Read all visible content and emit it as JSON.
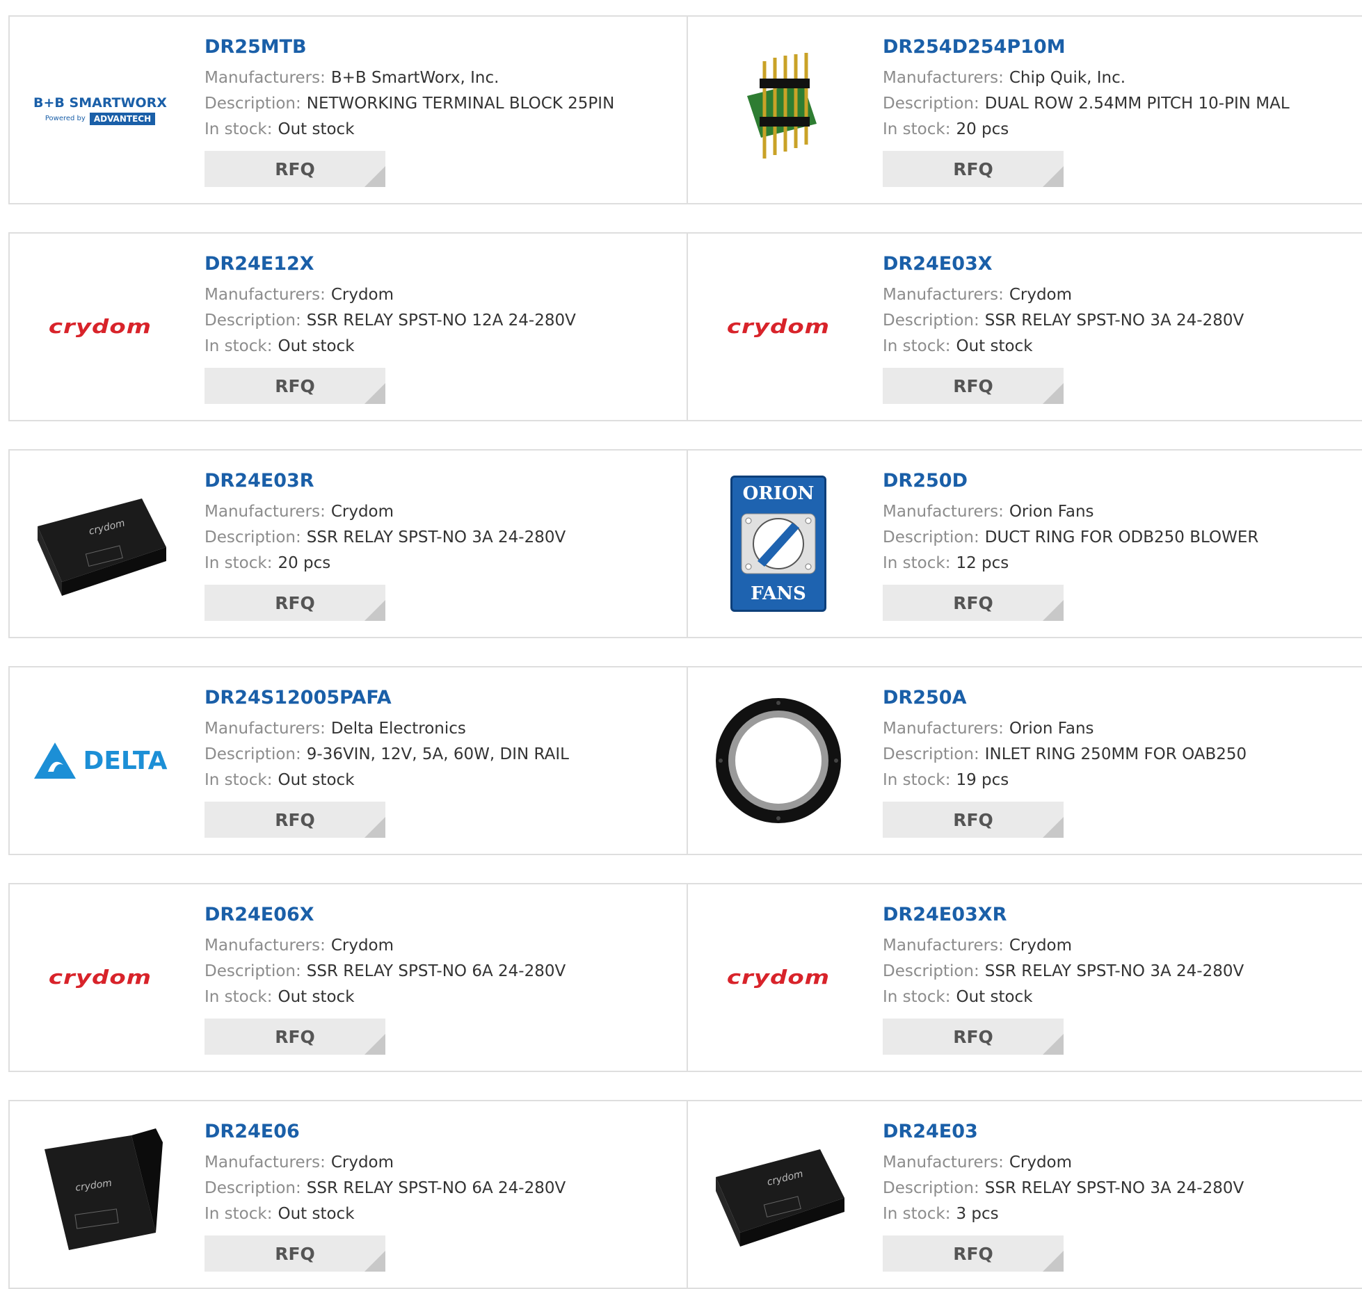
{
  "labels": {
    "manufacturer": "Manufacturers:",
    "description": "Description:",
    "stock": "In stock:",
    "rfq": "RFQ"
  },
  "logos": {
    "bb_top": "B+B SMARTWORX",
    "bb_powered": "Powered by",
    "bb_adv": "ADVANTECH",
    "crydom": "crydom",
    "delta": "DELTA",
    "orion_top": "ORION",
    "orion_bottom": "FANS"
  },
  "colors": {
    "part_link": "#1a5fa8",
    "label": "#8c8c8c",
    "rfq_bg": "#eaeaea",
    "border": "#dedede",
    "crydom_red": "#d8232a"
  },
  "products": [
    {
      "pn": "DR25MTB",
      "manufacturer": "B+B SmartWorx, Inc.",
      "description": "NETWORKING TERMINAL BLOCK 25PIN",
      "stock": "Out stock",
      "image": "bb-smartworx-logo"
    },
    {
      "pn": "DR254D254P10M",
      "manufacturer": "Chip Quik, Inc.",
      "description": "DUAL ROW 2.54MM PITCH 10-PIN MAL",
      "stock": "20 pcs",
      "image": "pin-header-photo"
    },
    {
      "pn": "DR24E12X",
      "manufacturer": "Crydom",
      "description": "SSR RELAY SPST-NO 12A 24-280V",
      "stock": "Out stock",
      "image": "crydom-logo"
    },
    {
      "pn": "DR24E03X",
      "manufacturer": "Crydom",
      "description": "SSR RELAY SPST-NO 3A 24-280V",
      "stock": "Out stock",
      "image": "crydom-logo"
    },
    {
      "pn": "DR24E03R",
      "manufacturer": "Crydom",
      "description": "SSR RELAY SPST-NO 3A 24-280V",
      "stock": "20 pcs",
      "image": "relay-photo"
    },
    {
      "pn": "DR250D",
      "manufacturer": "Orion Fans",
      "description": "DUCT RING FOR ODB250 BLOWER",
      "stock": "12 pcs",
      "image": "orion-fans-logo"
    },
    {
      "pn": "DR24S12005PAFA",
      "manufacturer": "Delta Electronics",
      "description": "9-36VIN, 12V, 5A, 60W, DIN RAIL",
      "stock": "Out stock",
      "image": "delta-logo"
    },
    {
      "pn": "DR250A",
      "manufacturer": "Orion Fans",
      "description": "INLET RING 250MM FOR OAB250",
      "stock": "19 pcs",
      "image": "inlet-ring-photo"
    },
    {
      "pn": "DR24E06X",
      "manufacturer": "Crydom",
      "description": "SSR RELAY SPST-NO 6A 24-280V",
      "stock": "Out stock",
      "image": "crydom-logo"
    },
    {
      "pn": "DR24E03XR",
      "manufacturer": "Crydom",
      "description": "SSR RELAY SPST-NO 3A 24-280V",
      "stock": "Out stock",
      "image": "crydom-logo"
    },
    {
      "pn": "DR24E06",
      "manufacturer": "Crydom",
      "description": "SSR RELAY SPST-NO 6A 24-280V",
      "stock": "Out stock",
      "image": "relay-photo"
    },
    {
      "pn": "DR24E03",
      "manufacturer": "Crydom",
      "description": "SSR RELAY SPST-NO 3A 24-280V",
      "stock": "3 pcs",
      "image": "relay-photo"
    }
  ]
}
